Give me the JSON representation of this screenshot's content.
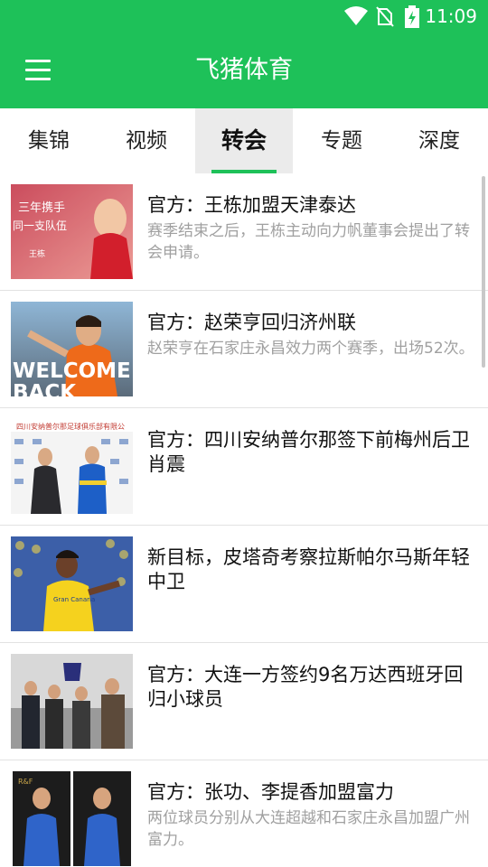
{
  "status_bar": {
    "time": "11:09"
  },
  "app": {
    "title": "飞猪体育"
  },
  "tabs": [
    {
      "label": "集锦"
    },
    {
      "label": "视频"
    },
    {
      "label": "转会"
    },
    {
      "label": "专题"
    },
    {
      "label": "深度"
    }
  ],
  "active_tab": "转会",
  "articles": [
    {
      "title": "官方：王栋加盟天津泰达",
      "desc": "赛季结束之后，王栋主动向力帆董事会提出了转会申请。",
      "thumb_text": [
        "三年携手",
        "同一支队伍",
        "王栋"
      ]
    },
    {
      "title": "官方：赵荣亨回归济州联",
      "desc": "赵荣亨在石家庄永昌效力两个赛季，出场52次。",
      "thumb_text": [
        "WELCOME",
        "BACK"
      ]
    },
    {
      "title": "官方：四川安纳普尔那签下前梅州后卫肖震",
      "desc": "",
      "thumb_text": [
        "四川安纳普尔那足球俱乐部有限公"
      ]
    },
    {
      "title": "新目标，皮塔奇考察拉斯帕尔马斯年轻中卫",
      "desc": "",
      "thumb_text": [
        "Gran Canaria"
      ]
    },
    {
      "title": "官方：大连一方签约9名万达西班牙回归小球员",
      "desc": "",
      "thumb_text": []
    },
    {
      "title": "官方：张功、李提香加盟富力",
      "desc": "两位球员分别从大连超越和石家庄永昌加盟广州富力。",
      "thumb_text": [
        "R&F"
      ]
    }
  ],
  "colors": {
    "brand": "#1ec159",
    "muted_text": "#a0a0a0"
  },
  "icons": [
    "wifi-icon",
    "no-sim-icon",
    "battery-charging-icon",
    "menu-icon"
  ]
}
